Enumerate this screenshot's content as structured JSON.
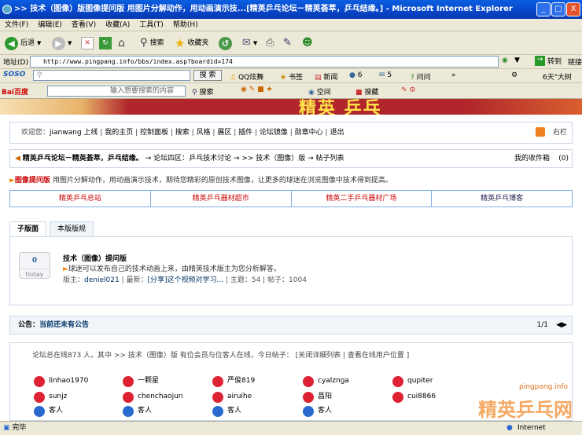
{
  "window": {
    "title": ">> 技术（图像）版图像提问版 用图片分解动作，用动画演示技...[精英乒乓论坛－精英荟萃，乒乓结缘。] - Microsoft Internet Explorer",
    "min": "_",
    "max": "□",
    "close": "X"
  },
  "menu": [
    "文件(F)",
    "编辑(E)",
    "查看(V)",
    "收藏(A)",
    "工具(T)",
    "帮助(H)"
  ],
  "toolbar": {
    "back": "后退",
    "search": "搜索",
    "favorites": "收藏夹"
  },
  "address": {
    "label": "地址(D)",
    "url": "http://www.pingpang.info/bbs/index.asp?boardid=174",
    "go": "转到",
    "links": "链接"
  },
  "soso": {
    "logo": "SOSO",
    "search_btn": "搜 索",
    "items": [
      "QQ炫舞",
      "书签",
      "新闻",
      "6",
      "5",
      "问问",
      "»"
    ],
    "right": "6天\"大树"
  },
  "baidu": {
    "logo": "Bai百度",
    "placeholder": "输入想要搜索的内容",
    "search": "搜索",
    "items": [
      "空间",
      "搜藏"
    ]
  },
  "banner": {
    "text": "精英 乒乓"
  },
  "userbar": {
    "greeting": "欢迎您：",
    "user": "jianwang",
    "items": [
      "上线",
      "我的主页",
      "控制面板",
      "搜索",
      "风格",
      "展区",
      "插件",
      "论坛镜像",
      "勋章中心",
      "退出"
    ],
    "right": "右栏"
  },
  "path": {
    "site": "精英乒乓论坛－精英荟萃，乒乓结缘。",
    "crumb": "→ 论坛四区：乒乓技术讨论 → >> 技术（图像）版 → 帖子列表",
    "inbox": "我的收件箱",
    "inbox_count": "(0)"
  },
  "board_desc": {
    "tag": "图像提问版",
    "text": "用图片分解动作，用动画演示技术，期待您精彩的原创技术图像，让更多的球迷在浏览图像中技术得到提高。"
  },
  "quicklinks": [
    "精英乒乓总站",
    "精英乒乓器材超市",
    "精英二手乒乓器材广场",
    "精英乒乓博客"
  ],
  "tabs": [
    "子版面",
    "本版版规"
  ],
  "subforum": {
    "count": "0",
    "today": "today",
    "name": "技术（图像）提问版",
    "desc": "球迷可以发布自己的技术动画上来，由精英技术版主为您分析解答。",
    "mods_label": "版主：",
    "mod": "deniel021",
    "latest_label": "| 最新：",
    "latest": "[分享]这个视频对学习...",
    "topics": "| 主题：54 | 帖子：1004"
  },
  "notice": {
    "label": "公告：",
    "text": "当前还未有公告",
    "page": "1/1"
  },
  "online": {
    "summary": "论坛总在线873 人，其中 >> 技术（图像）版 有位会员与位客人在线，今日帖子： [关闭详细列表 | 查看在线用户位置 ]",
    "users": [
      "linhao1970",
      "一颗星",
      "严俊819",
      "cyalznga",
      "qupiter",
      "sunjz",
      "chenchaojun",
      "airuihe",
      "昌阳",
      "cui8866",
      "客人",
      "客人",
      "客人",
      "客人"
    ]
  },
  "status": {
    "text": "完毕",
    "zone": "Internet"
  },
  "watermark": {
    "domain": "pingpang.info",
    "name": "精英乒乓网"
  },
  "colors": {
    "title": "#0845c8",
    "link": "#c00000",
    "border": "#c9d6e8"
  }
}
